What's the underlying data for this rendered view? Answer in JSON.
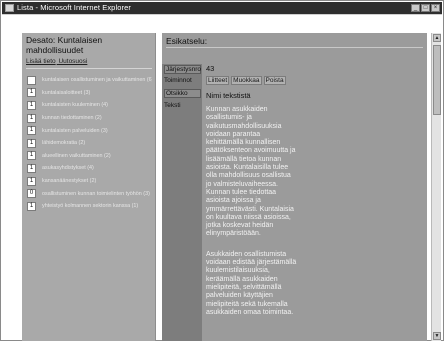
{
  "window": {
    "title": "Lista - Microsoft Internet Explorer",
    "controls": [
      "_",
      "□",
      "×"
    ]
  },
  "left": {
    "title": "Desato: Kuntalaisen mahdollisuudet",
    "links": [
      "Lisää tieto",
      "Uutosuosi"
    ],
    "options": [
      {
        "box": "",
        "label": "kuntalaisen osallistuminen ja vaikuttaminen (6)"
      },
      {
        "box": "1",
        "label": "kuntalaisaloitteet (3)"
      },
      {
        "box": "1",
        "label": "kuntalaisten kuuleminen (4)"
      },
      {
        "box": "1",
        "label": "kunnan tiedottaminen (2)"
      },
      {
        "box": "1",
        "label": "kuntalaisten palveluiden (3)"
      },
      {
        "box": "1",
        "label": "lähidemokratia (2)"
      },
      {
        "box": "1",
        "label": "alueellinen vaikuttaminen (2)"
      },
      {
        "box": "1",
        "label": "asukasyhdistykset (4)"
      },
      {
        "box": "1",
        "label": "kansanäänestykset (2)"
      },
      {
        "box": "0",
        "label": "osallistuminen kunnan toimielinten työhön (3)"
      },
      {
        "box": "1",
        "label": "yhteistyö kolmannen sektorin kanssa (1)"
      }
    ]
  },
  "right": {
    "title": "Esikatselu:",
    "fields": {
      "number_label": "Järjestysnro",
      "number_value": "43",
      "actions_label": "Toiminnot",
      "actions": [
        "Liitteet",
        "Muokkaa",
        "Poista"
      ],
      "title_label": "Otsikko",
      "title_value": "Nimi tekstistä",
      "text_label": "Teksti"
    },
    "body_paragraphs": [
      "Kunnan asukkaiden osallistumis- ja vaikutusmahdollisuuksia voidaan parantaa kehittämällä kunnallisen päätöksenteon avoimuutta ja lisäämällä tietoa kunnan asioista. Kuntalaisilla tulee olla mahdollisuus osallistua jo valmisteluvaiheessa. Kunnan tulee tiedottaa asioista ajoissa ja ymmärrettävästi. Kuntalaisia on kuultava niissä asioissa, jotka koskevat heidän elinympäristöään.",
      "Asukkaiden osallistumista voidaan edistää järjestämällä kuulemistilaisuuksia, keräämällä asukkaiden mielipiteitä, selvittämällä palveluiden käyttäjien mielipiteitä sekä tukemalla asukkaiden omaa toimintaa."
    ]
  },
  "scrollbar": {
    "up": "▲",
    "down": "▼"
  }
}
